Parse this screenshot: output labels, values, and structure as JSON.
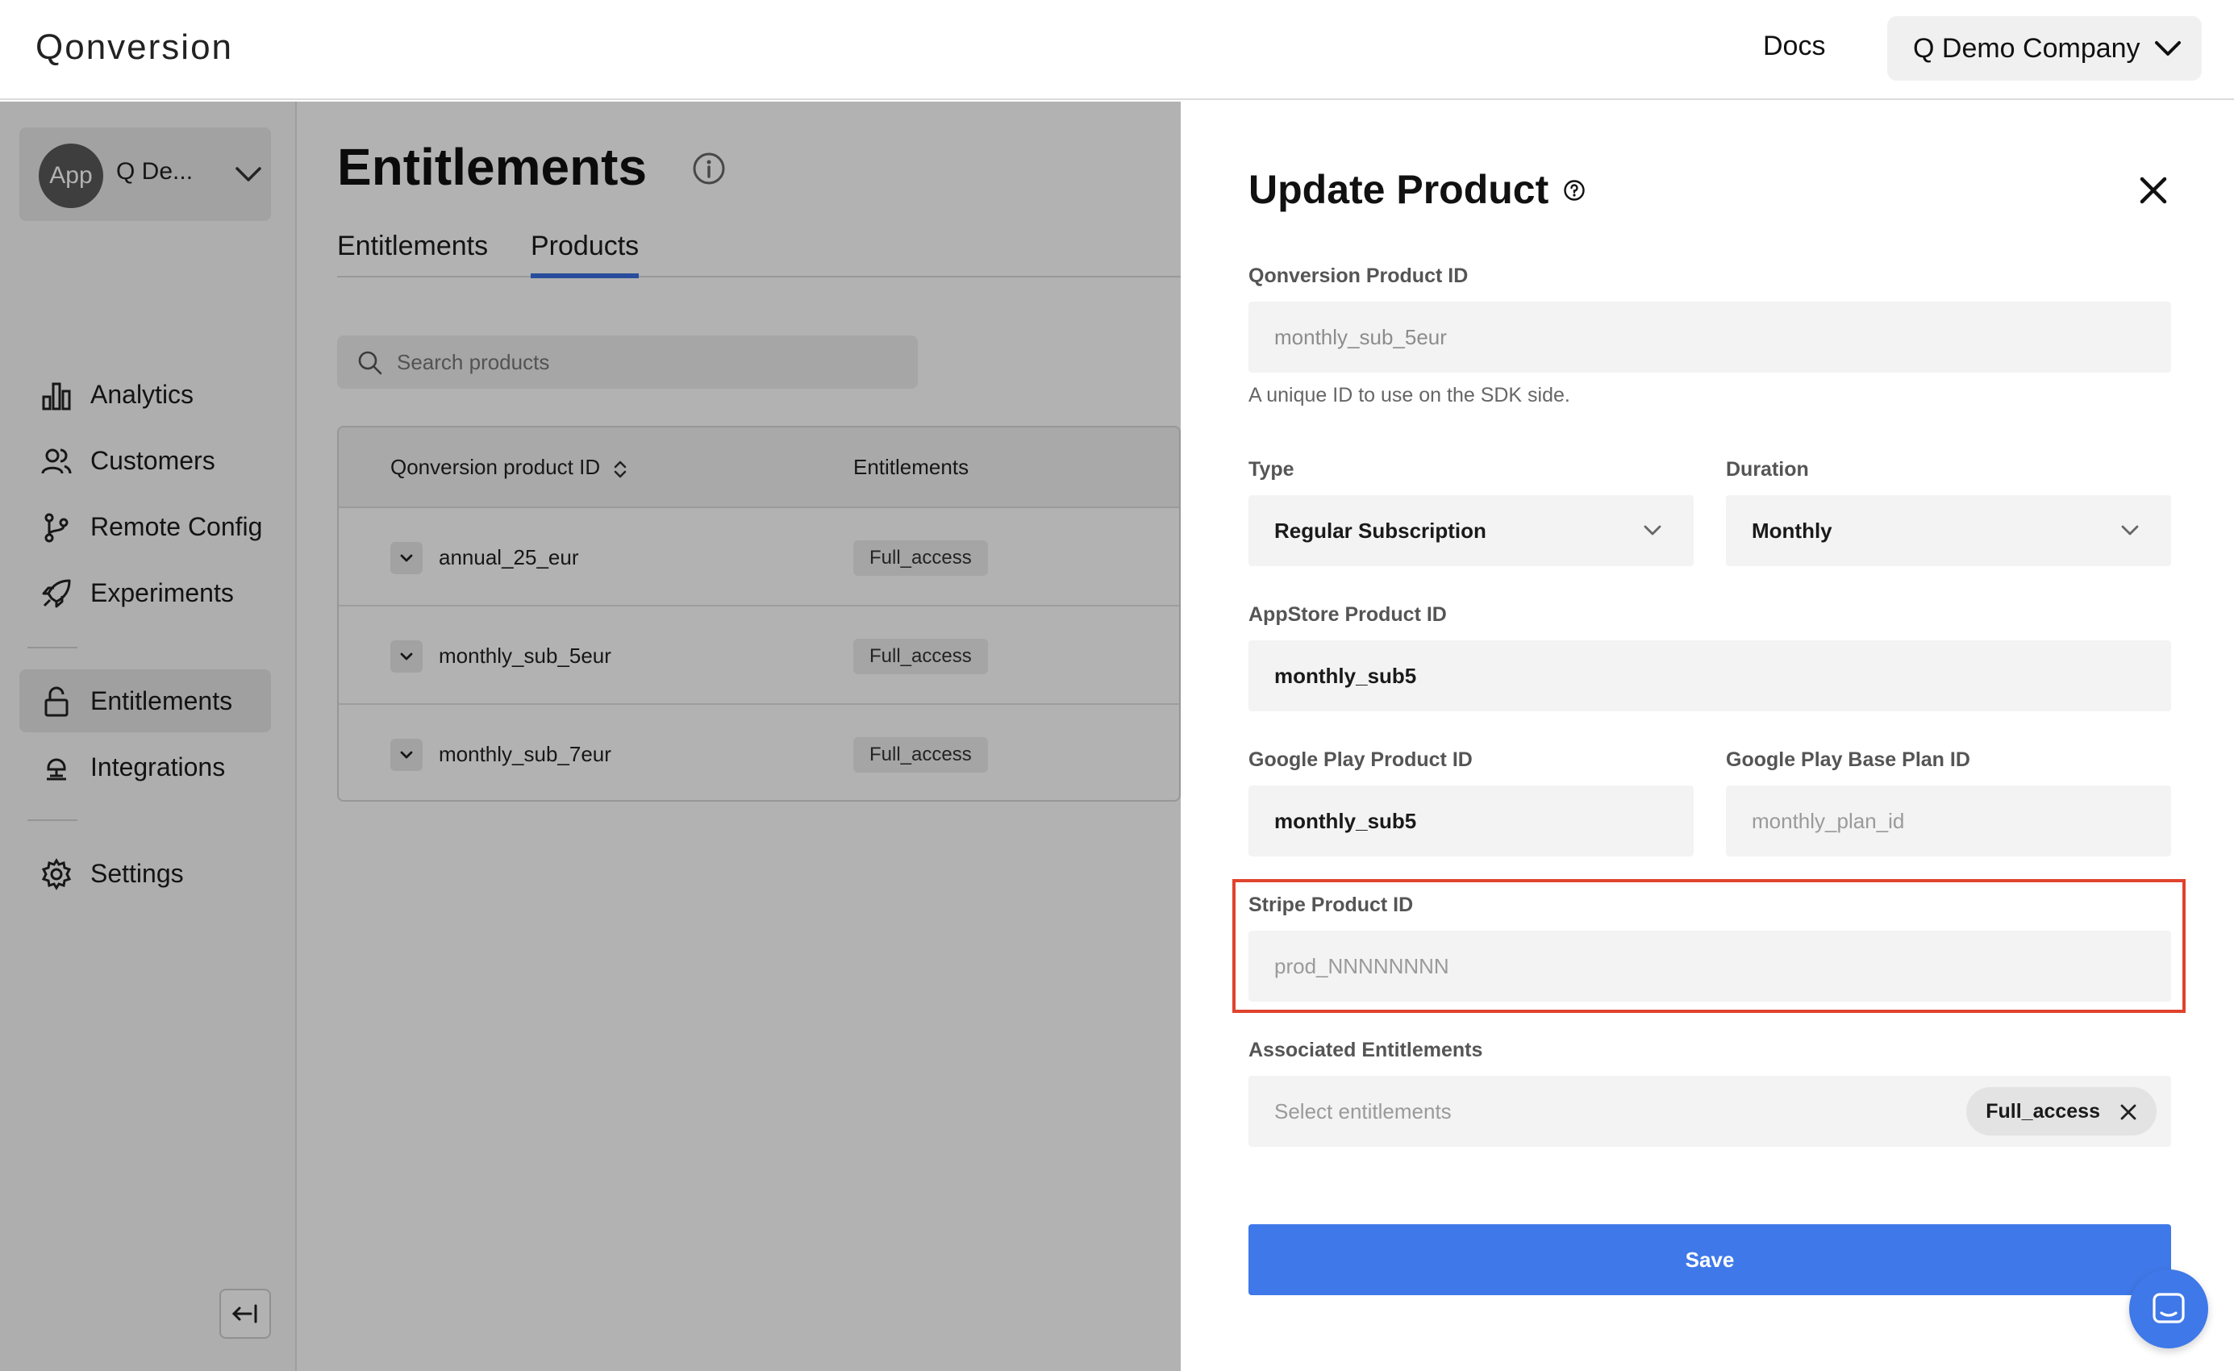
{
  "header": {
    "logo": "Qonversion",
    "docs_label": "Docs",
    "company_name": "Q Demo Company"
  },
  "sidebar": {
    "app_avatar": "App",
    "app_name": "Q De...",
    "items": [
      {
        "label": "Analytics",
        "icon": "bar-chart-icon"
      },
      {
        "label": "Customers",
        "icon": "users-icon"
      },
      {
        "label": "Remote Config",
        "icon": "branch-icon"
      },
      {
        "label": "Experiments",
        "icon": "rocket-icon"
      },
      {
        "label": "Entitlements",
        "icon": "lock-icon",
        "active": true
      },
      {
        "label": "Integrations",
        "icon": "integrations-icon"
      },
      {
        "label": "Settings",
        "icon": "gear-icon"
      }
    ]
  },
  "main": {
    "title": "Entitlements",
    "tabs": [
      {
        "label": "Entitlements",
        "active": false
      },
      {
        "label": "Products",
        "active": true
      }
    ],
    "search_placeholder": "Search products",
    "table": {
      "columns": [
        "Qonversion product ID",
        "Entitlements"
      ],
      "rows": [
        {
          "id": "annual_25_eur",
          "entitlement": "Full_access"
        },
        {
          "id": "monthly_sub_5eur",
          "entitlement": "Full_access"
        },
        {
          "id": "monthly_sub_7eur",
          "entitlement": "Full_access"
        }
      ]
    }
  },
  "drawer": {
    "title": "Update Product",
    "product_id_label": "Qonversion Product ID",
    "product_id_value": "monthly_sub_5eur",
    "product_id_hint": "A unique ID to use on the SDK side.",
    "type_label": "Type",
    "type_value": "Regular Subscription",
    "duration_label": "Duration",
    "duration_value": "Monthly",
    "appstore_label": "AppStore Product ID",
    "appstore_value": "monthly_sub5",
    "gplay_label": "Google Play Product ID",
    "gplay_value": "monthly_sub5",
    "gplay_base_label": "Google Play Base Plan ID",
    "gplay_base_placeholder": "monthly_plan_id",
    "stripe_label": "Stripe Product ID",
    "stripe_placeholder": "prod_NNNNNNNN",
    "entitlements_label": "Associated Entitlements",
    "entitlements_placeholder": "Select entitlements",
    "entitlement_chip": "Full_access",
    "save_label": "Save"
  },
  "colors": {
    "accent": "#3f78e8",
    "highlight": "#e0432d"
  }
}
